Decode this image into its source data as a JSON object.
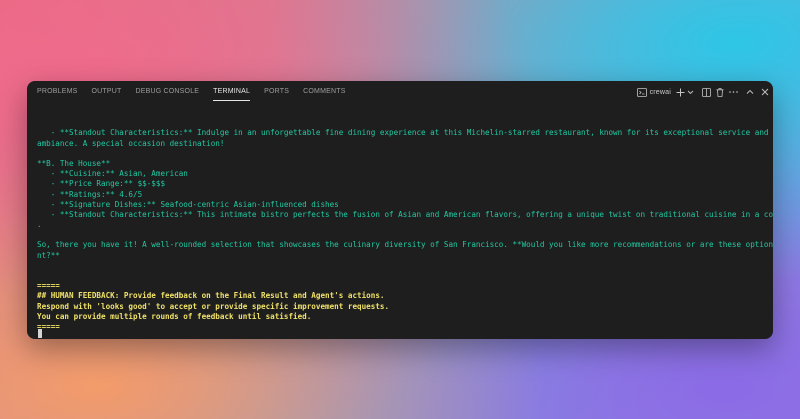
{
  "panel": {
    "tabs": [
      {
        "label": "PROBLEMS",
        "active": false
      },
      {
        "label": "OUTPUT",
        "active": false
      },
      {
        "label": "DEBUG CONSOLE",
        "active": false
      },
      {
        "label": "TERMINAL",
        "active": true
      },
      {
        "label": "PORTS",
        "active": false
      },
      {
        "label": "COMMENTS",
        "active": false
      }
    ],
    "terminal_name": "crewai",
    "tool_icons": [
      "terminal-icon",
      "plus-icon",
      "chevron-down-icon",
      "split-icon",
      "trash-icon",
      "ellipsis-icon",
      "chevron-up-icon",
      "close-icon"
    ]
  },
  "terminal": {
    "lines": [
      {
        "text": "   - **Standout Characteristics:** Indulge in an unforgettable fine dining experience at this Michelin-starred restaurant, known for its exceptional service and luxurious",
        "style": "green"
      },
      {
        "text": "ambiance. A special occasion destination!",
        "style": "green"
      },
      {
        "text": "",
        "style": "green"
      },
      {
        "text": "**B. The House**",
        "style": "green"
      },
      {
        "text": "   - **Cuisine:** Asian, American",
        "style": "green"
      },
      {
        "text": "   - **Price Range:** $$-$$$",
        "style": "green"
      },
      {
        "text": "   - **Ratings:** 4.6/5",
        "style": "green"
      },
      {
        "text": "   - **Signature Dishes:** Seafood-centric Asian-influenced dishes",
        "style": "green"
      },
      {
        "text": "   - **Standout Characteristics:** This intimate bistro perfects the fusion of Asian and American flavors, offering a unique twist on traditional cuisine in a cozy setting",
        "style": "green"
      },
      {
        "text": ".",
        "style": "green"
      },
      {
        "text": "",
        "style": "green"
      },
      {
        "text": "So, there you have it! A well-rounded selection that showcases the culinary diversity of San Francisco. **Would you like more recommendations or are these options sufficie",
        "style": "green"
      },
      {
        "text": "nt?**",
        "style": "green"
      },
      {
        "text": "",
        "style": "green"
      },
      {
        "text": "",
        "style": "green"
      },
      {
        "text": "=====",
        "style": "yellow"
      },
      {
        "text": "## HUMAN FEEDBACK: Provide feedback on the Final Result and Agent's actions.",
        "style": "yellow"
      },
      {
        "text": "Respond with 'looks good' to accept or provide specific improvement requests.",
        "style": "yellow"
      },
      {
        "text": "You can provide multiple rounds of feedback until satisfied.",
        "style": "yellow"
      },
      {
        "text": "=====",
        "style": "yellow"
      }
    ]
  },
  "colors": {
    "terminal_text": "#21c9a2",
    "feedback_text": "#f1e26a",
    "terminal_bg": "#1e1e1e"
  }
}
